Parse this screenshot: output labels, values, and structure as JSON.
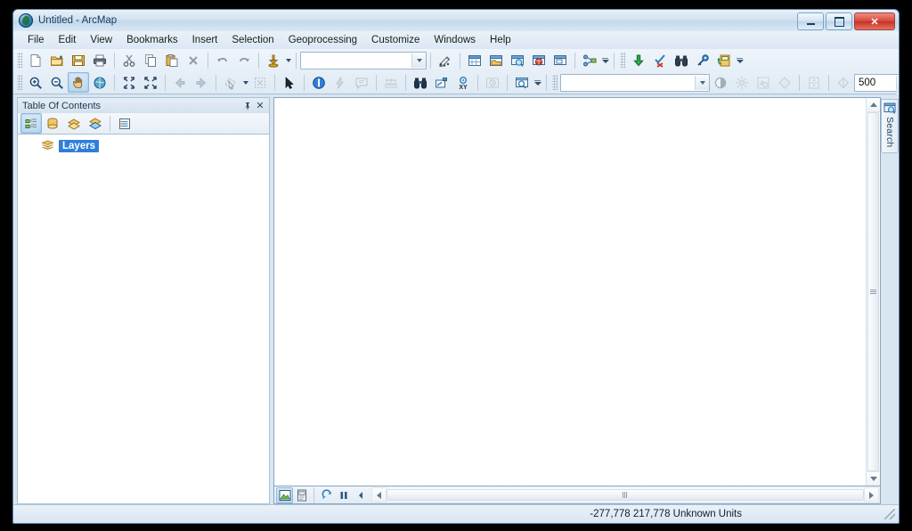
{
  "window": {
    "title": "Untitled - ArcMap",
    "icon": "arcmap-globe-icon",
    "minimize_label": "Minimize",
    "maximize_label": "Maximize",
    "close_label": "Close"
  },
  "menubar": {
    "items": [
      {
        "label": "File",
        "name": "menu-file"
      },
      {
        "label": "Edit",
        "name": "menu-edit"
      },
      {
        "label": "View",
        "name": "menu-view"
      },
      {
        "label": "Bookmarks",
        "name": "menu-bookmarks"
      },
      {
        "label": "Insert",
        "name": "menu-insert"
      },
      {
        "label": "Selection",
        "name": "menu-selection"
      },
      {
        "label": "Geoprocessing",
        "name": "menu-geoprocessing"
      },
      {
        "label": "Customize",
        "name": "menu-customize"
      },
      {
        "label": "Windows",
        "name": "menu-windows"
      },
      {
        "label": "Help",
        "name": "menu-help"
      }
    ]
  },
  "standard_toolbar": {
    "buttons": [
      {
        "name": "new-map-icon",
        "title": "New"
      },
      {
        "name": "open-folder-icon",
        "title": "Open"
      },
      {
        "name": "save-icon",
        "title": "Save"
      },
      {
        "name": "print-icon",
        "title": "Print"
      },
      {
        "name": "cut-icon",
        "title": "Cut"
      },
      {
        "name": "copy-icon",
        "title": "Copy"
      },
      {
        "name": "paste-icon",
        "title": "Paste"
      },
      {
        "name": "delete-icon",
        "title": "Delete"
      },
      {
        "name": "undo-icon",
        "title": "Undo"
      },
      {
        "name": "redo-icon",
        "title": "Redo"
      },
      {
        "name": "add-data-icon",
        "title": "Add Data"
      }
    ],
    "scale_combo": {
      "name": "map-scale-combo",
      "value": "",
      "placeholder": ""
    },
    "right_buttons": [
      {
        "name": "editor-toolbar-icon",
        "title": "Editor Toolbar"
      },
      {
        "name": "table-of-contents-icon",
        "title": "Table Of Contents"
      },
      {
        "name": "catalog-window-icon",
        "title": "Catalog"
      },
      {
        "name": "search-window-icon",
        "title": "Search"
      },
      {
        "name": "arcglobe-icon",
        "title": "ArcGlobe"
      },
      {
        "name": "arcscene-icon",
        "title": "ArcScene"
      },
      {
        "name": "model-builder-icon",
        "title": "ModelBuilder"
      }
    ],
    "far_buttons": [
      {
        "name": "add-green-arrow-icon",
        "title": "Add"
      },
      {
        "name": "clear-selection-icon",
        "title": "Clear Selected Features"
      },
      {
        "name": "find-binoculars-icon",
        "title": "Find"
      },
      {
        "name": "identify-key-icon",
        "title": "Identify"
      },
      {
        "name": "add-to-catalog-icon",
        "title": "Add To Catalog"
      }
    ]
  },
  "tools_toolbar": {
    "buttons": [
      {
        "name": "zoom-in-icon",
        "title": "Zoom In",
        "state": "normal"
      },
      {
        "name": "zoom-out-icon",
        "title": "Zoom Out",
        "state": "normal"
      },
      {
        "name": "pan-hand-icon",
        "title": "Pan",
        "state": "active"
      },
      {
        "name": "full-extent-globe-icon",
        "title": "Full Extent",
        "state": "normal"
      },
      {
        "name": "fixed-zoom-in-icon",
        "title": "Fixed Zoom In",
        "state": "normal"
      },
      {
        "name": "fixed-zoom-out-icon",
        "title": "Fixed Zoom Out",
        "state": "normal"
      },
      {
        "name": "go-back-extent-icon",
        "title": "Go Back To Previous Extent",
        "state": "disabled"
      },
      {
        "name": "go-forward-extent-icon",
        "title": "Go To Next Extent",
        "state": "disabled"
      },
      {
        "name": "select-features-icon",
        "title": "Select Features",
        "state": "disabled"
      },
      {
        "name": "clear-selected-features-icon",
        "title": "Clear Selected Features",
        "state": "disabled"
      },
      {
        "name": "select-elements-arrow-icon",
        "title": "Select Elements",
        "state": "normal"
      },
      {
        "name": "identify-info-icon",
        "title": "Identify",
        "state": "normal"
      },
      {
        "name": "hyperlink-lightning-icon",
        "title": "Hyperlink",
        "state": "disabled"
      },
      {
        "name": "html-popup-icon",
        "title": "HTML Popup",
        "state": "disabled"
      },
      {
        "name": "measure-ruler-icon",
        "title": "Measure",
        "state": "disabled"
      },
      {
        "name": "find-icon",
        "title": "Find",
        "state": "normal"
      },
      {
        "name": "find-route-icon",
        "title": "Find Route",
        "state": "normal"
      },
      {
        "name": "go-to-xy-icon",
        "title": "Go To XY",
        "state": "normal"
      },
      {
        "name": "time-slider-icon",
        "title": "Time Slider",
        "state": "disabled"
      },
      {
        "name": "create-viewer-window-icon",
        "title": "Create Viewer Window",
        "state": "normal"
      }
    ]
  },
  "effects_toolbar": {
    "layer_combo": {
      "name": "effects-layer-combo",
      "value": ""
    },
    "buttons": [
      {
        "name": "contrast-icon",
        "title": "Contrast",
        "state": "disabled"
      },
      {
        "name": "brightness-icon",
        "title": "Brightness",
        "state": "disabled"
      },
      {
        "name": "transparency-icon",
        "title": "Transparency",
        "state": "disabled"
      },
      {
        "name": "swipe-diamond-icon",
        "title": "Swipe Layer",
        "state": "disabled"
      },
      {
        "name": "flicker-icon",
        "title": "Flicker",
        "state": "disabled"
      },
      {
        "name": "swipe-layer-icon",
        "title": "Swipe",
        "state": "disabled"
      }
    ],
    "flicker_rate": {
      "name": "flicker-rate-spinner",
      "value": "500"
    }
  },
  "table_of_contents": {
    "title": "Table Of Contents",
    "pin_label": "⚲",
    "close_label": "✕",
    "toolbar": [
      {
        "name": "list-by-drawing-order-icon",
        "title": "List By Drawing Order",
        "state": "active"
      },
      {
        "name": "list-by-source-icon",
        "title": "List By Source",
        "state": "normal"
      },
      {
        "name": "list-by-visibility-icon",
        "title": "List By Visibility",
        "state": "normal"
      },
      {
        "name": "list-by-selection-icon",
        "title": "List By Selection",
        "state": "normal"
      },
      {
        "name": "toc-options-icon",
        "title": "Options",
        "state": "normal"
      }
    ],
    "tree": [
      {
        "name": "toc-item-layers",
        "label": "Layers",
        "icon": "layers-stack-icon",
        "selected": true
      }
    ]
  },
  "map_view": {
    "view_buttons": [
      {
        "name": "data-view-button",
        "title": "Data View",
        "state": "active"
      },
      {
        "name": "layout-view-button",
        "title": "Layout View",
        "state": "normal"
      }
    ],
    "draw_buttons": [
      {
        "name": "refresh-view-icon",
        "title": "Refresh View",
        "state": "normal"
      },
      {
        "name": "pause-drawing-icon",
        "title": "Pause Drawing",
        "state": "normal"
      },
      {
        "name": "toggle-panel-icon",
        "title": "Toggle",
        "state": "normal"
      }
    ]
  },
  "right_dock": {
    "tabs": [
      {
        "name": "search-panel-tab",
        "label": "Search",
        "icon": "search-window-icon"
      }
    ]
  },
  "status_bar": {
    "left_text": "",
    "coordinates": "-277,778  217,778 Unknown Units"
  },
  "colors": {
    "accent": "#2f7fd8",
    "title_text": "#123a5c",
    "chrome": "#d8e6f2",
    "close_red": "#c23326"
  }
}
